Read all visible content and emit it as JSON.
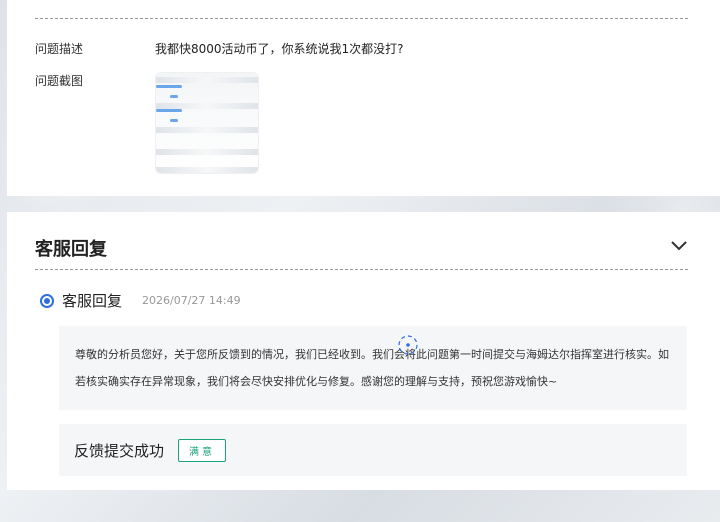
{
  "problem": {
    "desc_label": "问题描述",
    "desc_value": "我都快8000活动币了，你系统说我1次都没打?",
    "screenshot_label": "问题截图"
  },
  "reply_section": {
    "title": "客服回复",
    "reply": {
      "title": "客服回复",
      "time": "2026/07/27 14:49",
      "content": "尊敬的分析员您好，关于您所反馈到的情况，我们已经收到。我们会将此问题第一时间提交与海姆达尔指挥室进行核实。如若核实确实存在异常现象，我们将会尽快安排优化与修复。感谢您的理解与支持，预祝您游戏愉快~"
    },
    "status": {
      "text": "反馈提交成功",
      "badge": "满意"
    }
  },
  "colors": {
    "accent": "#2d6fe0",
    "badge_green": "#1aa37a"
  },
  "icons": [
    "chevron-down-icon",
    "radio-icon",
    "loading-icon"
  ]
}
